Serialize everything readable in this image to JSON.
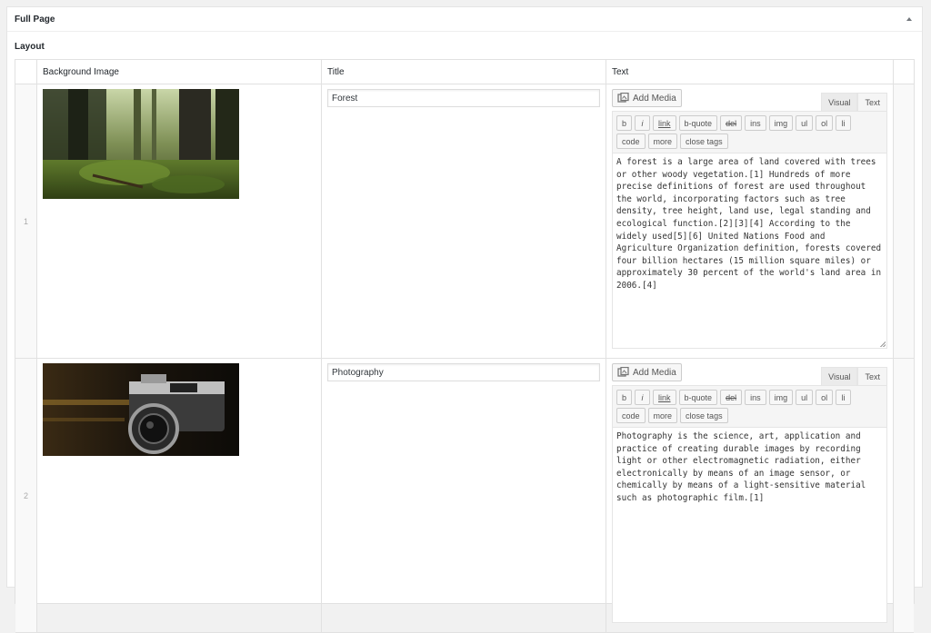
{
  "box": {
    "title": "Full Page"
  },
  "field": {
    "label": "Layout"
  },
  "table": {
    "headers": {
      "image": "Background Image",
      "title": "Title",
      "text": "Text"
    }
  },
  "rows": [
    {
      "index": "1",
      "title": "Forest",
      "image_subject": "forest",
      "text": "A forest is a large area of land covered with trees or other woody vegetation.[1] Hundreds of more precise definitions of forest are used throughout the world, incorporating factors such as tree density, tree height, land use, legal standing and ecological function.[2][3][4] According to the widely used[5][6] United Nations Food and Agriculture Organization definition, forests covered four billion hectares (15 million square miles) or approximately 30 percent of the world's land area in 2006.[4]"
    },
    {
      "index": "2",
      "title": "Photography",
      "image_subject": "camera",
      "text": "Photography is the science, art, application and practice of creating durable images by recording light or other electromagnetic radiation, either electronically by means of an image sensor, or chemically by means of a light-sensitive material such as photographic film.[1]"
    }
  ],
  "editor": {
    "add_media": "Add Media",
    "tab_visual": "Visual",
    "tab_text": "Text",
    "buttons": [
      "b",
      "i",
      "link",
      "b-quote",
      "del",
      "ins",
      "img",
      "ul",
      "ol",
      "li",
      "code",
      "more",
      "close tags"
    ]
  },
  "icons": {
    "toggle": "triangle-up-icon",
    "media": "add-media-icon"
  }
}
